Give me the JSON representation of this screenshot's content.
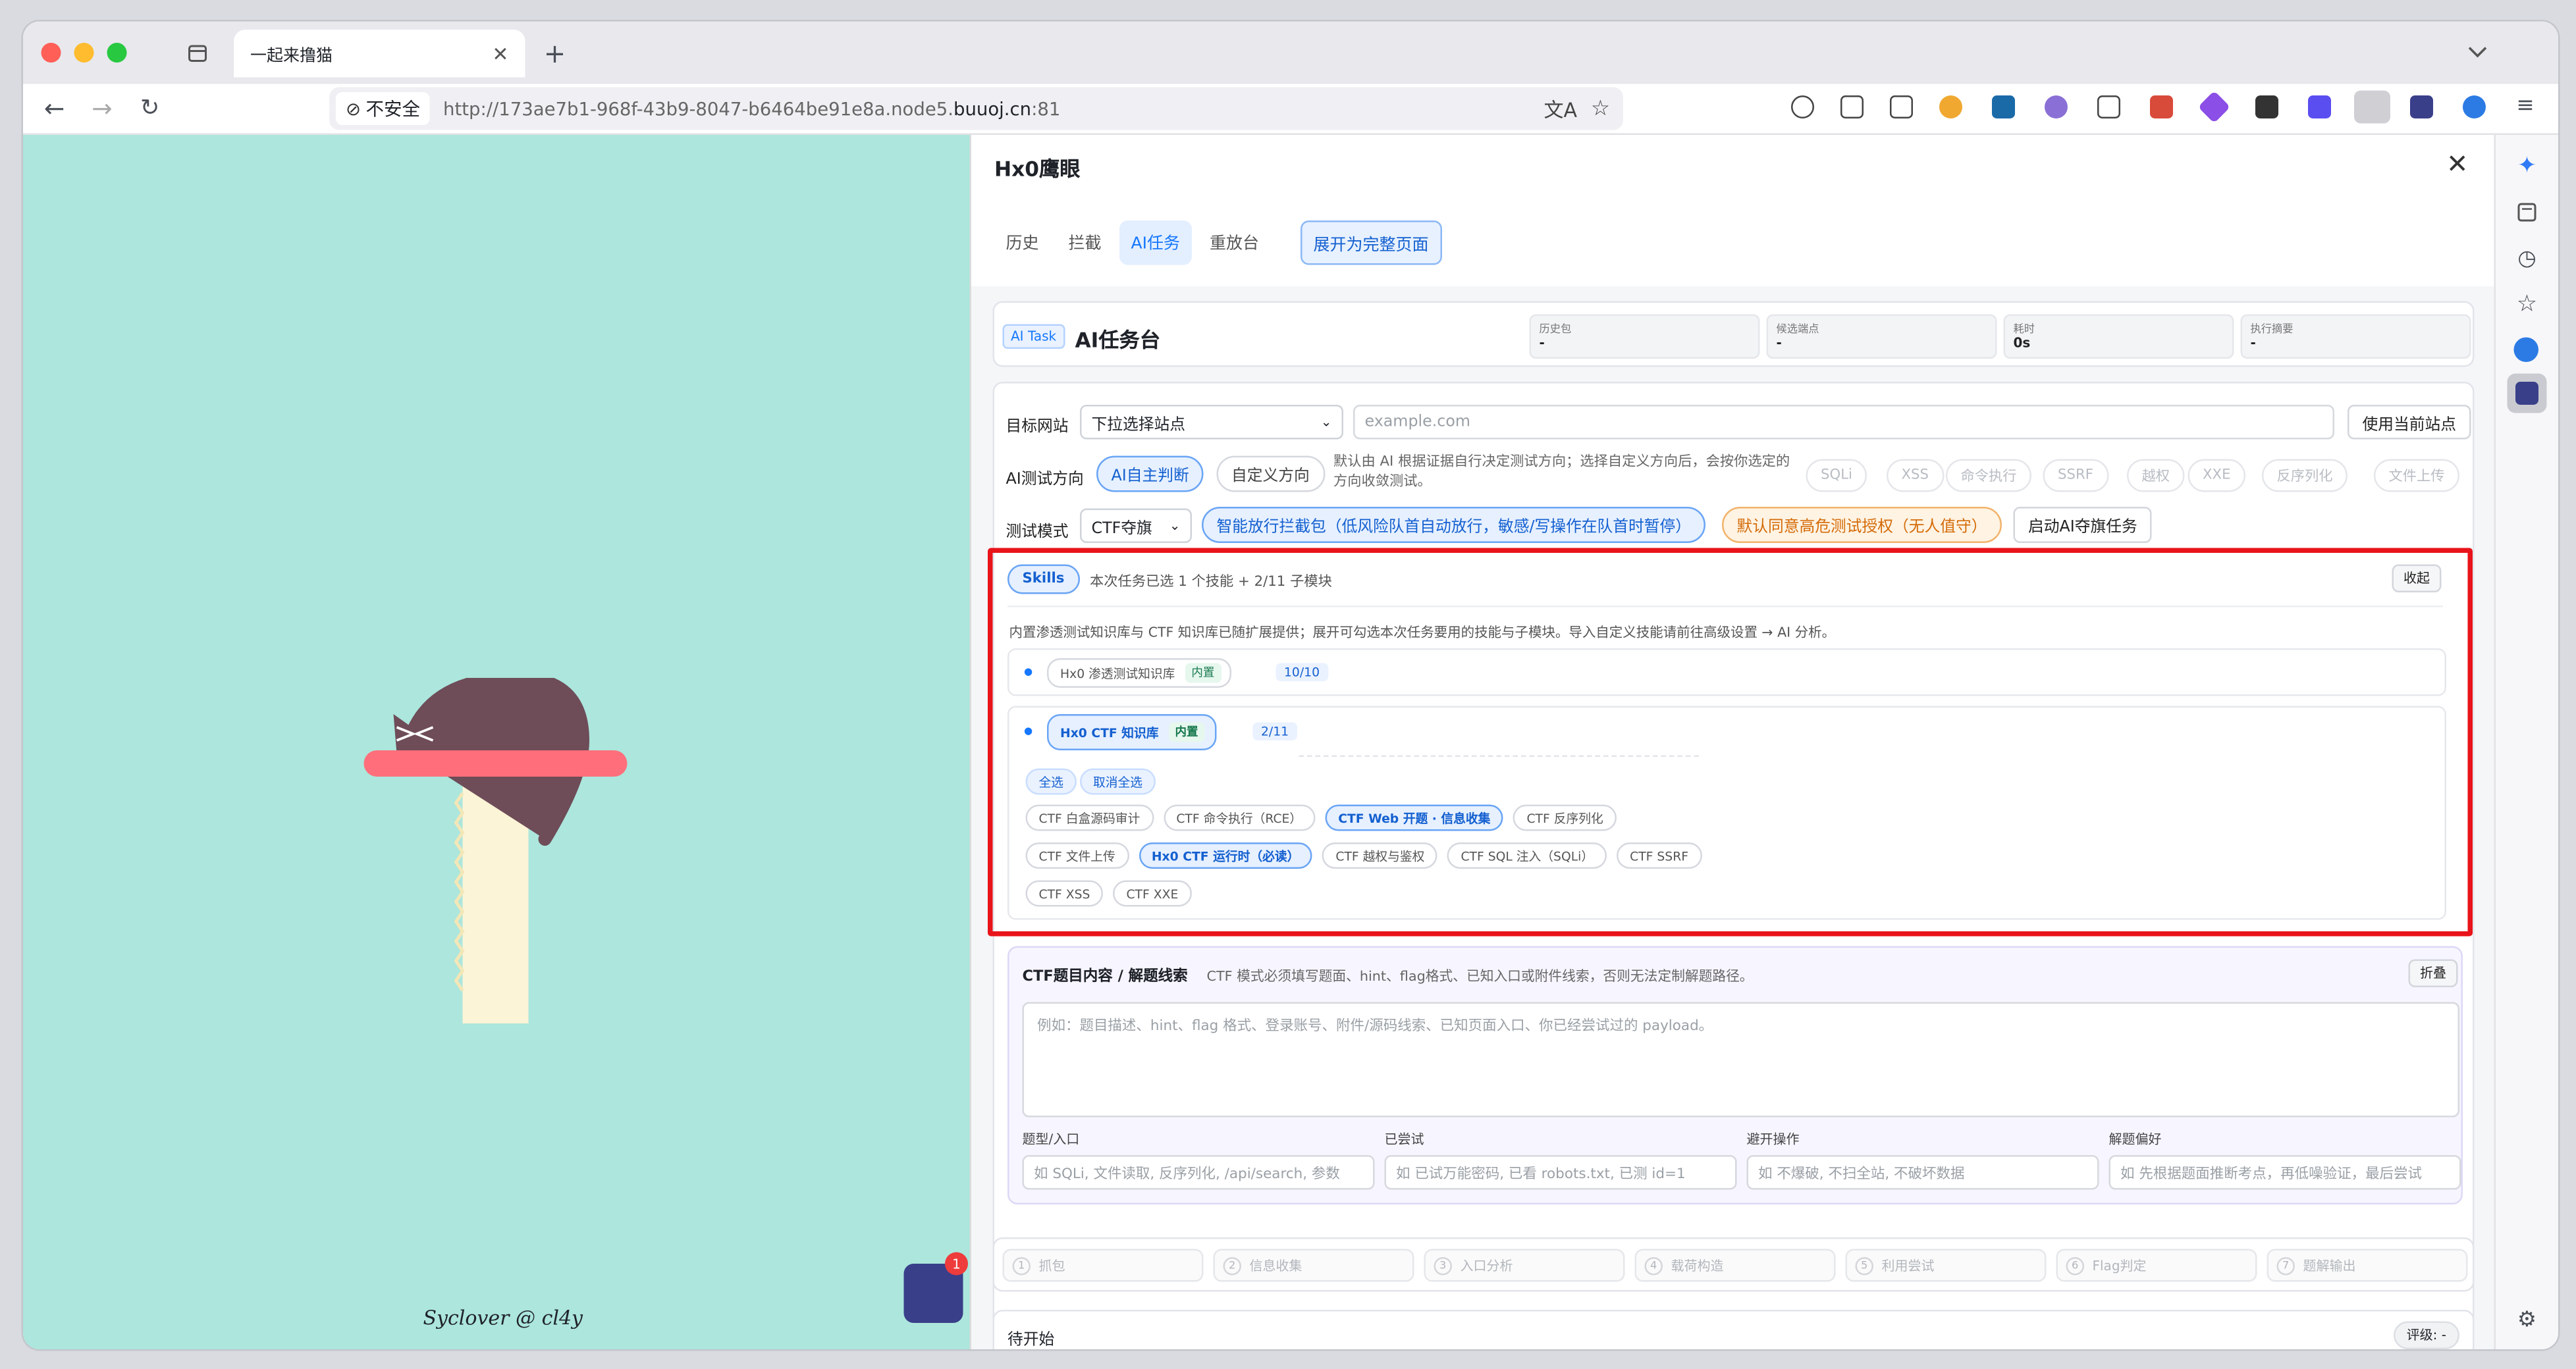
{
  "browser": {
    "tab_title": "一起来撸猫",
    "insecure_label": "不安全",
    "url_prefix": "http://173ae7b1-968f-43b9-8047-b6464be91e8a.node5.",
    "url_host": "buuoj.cn",
    "url_port": ":81"
  },
  "page": {
    "signature": "Syclover @ cl4y",
    "notif_count": "1"
  },
  "panel": {
    "title": "Hx0鹰眼",
    "tabs": [
      "历史",
      "拦截",
      "AI任务",
      "重放台"
    ],
    "expand_label": "展开为完整页面",
    "task_badge": "AI Task",
    "task_title": "AI任务台",
    "stats": [
      {
        "label": "历史包",
        "value": "-"
      },
      {
        "label": "候选端点",
        "value": "-"
      },
      {
        "label": "耗时",
        "value": "0s"
      },
      {
        "label": "执行摘要",
        "value": "-"
      }
    ],
    "target": {
      "label": "目标网站",
      "select": "下拉选择站点",
      "placeholder": "example.com",
      "use_current": "使用当前站点"
    },
    "direction": {
      "label": "AI测试方向",
      "auto": "AI自主判断",
      "custom": "自定义方向",
      "hint": "默认由 AI 根据证据自行决定测试方向；选择自定义方向后，会按你选定的方向收敛测试。",
      "options": [
        "SQLi",
        "XSS",
        "命令执行",
        "SSRF",
        "越权",
        "XXE",
        "反序列化",
        "文件上传"
      ]
    },
    "mode": {
      "label": "测试模式",
      "select": "CTF夺旗",
      "smart": "智能放行拦截包（低风险队首自动放行，敏感/写操作在队首时暂停）",
      "default_auth": "默认同意高危测试授权（无人值守）",
      "start": "启动AI夺旗任务"
    },
    "skills": {
      "badge": "Skills",
      "summary": "本次任务已选 1 个技能 + 2/11 子模块",
      "collapse": "收起",
      "desc": "内置渗透测试知识库与 CTF 知识库已随扩展提供；展开可勾选本次任务要用的技能与子模块。导入自定义技能请前往高级设置 → AI 分析。",
      "kb1": {
        "name": "Hx0 渗透测试知识库",
        "tag": "内置",
        "count": "10/10"
      },
      "kb2": {
        "name": "Hx0 CTF 知识库",
        "tag": "内置",
        "count": "2/11"
      },
      "select_all": "全选",
      "deselect_all": "取消全选",
      "rows": [
        [
          "CTF 白盒源码审计",
          "CTF 命令执行（RCE）",
          "CTF Web 开题 · 信息收集",
          "CTF 反序列化"
        ],
        [
          "CTF 文件上传",
          "Hx0 CTF 运行时（必读）",
          "CTF 越权与鉴权",
          "CTF SQL 注入（SQLi）",
          "CTF SSRF"
        ],
        [
          "CTF XSS",
          "CTF XXE"
        ]
      ],
      "selected": [
        "CTF Web 开题 · 信息收集",
        "Hx0 CTF 运行时（必读）"
      ]
    },
    "ctf": {
      "title": "CTF题目内容 / 解题线索",
      "hint": "CTF 模式必须填写题面、hint、flag格式、已知入口或附件线索，否则无法定制解题路径。",
      "fold": "折叠",
      "placeholder": "例如：题目描述、hint、flag 格式、登录账号、附件/源码线索、已知页面入口、你已经尝试过的 payload。",
      "fields": [
        {
          "label": "题型/入口",
          "placeholder": "如 SQLi, 文件读取, 反序列化, /api/search, 参数"
        },
        {
          "label": "已尝试",
          "placeholder": "如 已试万能密码, 已看 robots.txt, 已测 id=1"
        },
        {
          "label": "避开操作",
          "placeholder": "如 不爆破, 不扫全站, 不破坏数据"
        },
        {
          "label": "解题偏好",
          "placeholder": "如 先根据题面推断考点，再低噪验证，最后尝试"
        }
      ]
    },
    "steps": [
      "抓包",
      "信息收集",
      "入口分析",
      "载荷构造",
      "利用尝试",
      "Flag判定",
      "题解输出"
    ],
    "status": {
      "text": "待开始",
      "rating": "评级: -"
    }
  }
}
